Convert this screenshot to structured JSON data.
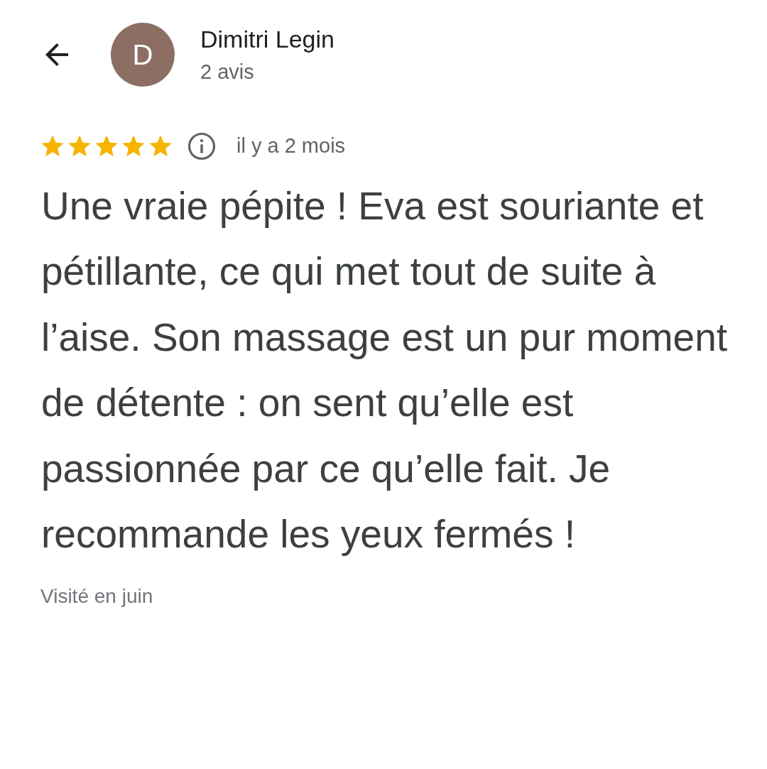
{
  "reviewer": {
    "initial": "D",
    "name": "Dimitri Legin",
    "review_count": "2 avis"
  },
  "review": {
    "stars": 5,
    "time": "il y a 2 mois",
    "text": "Une vraie pépite ! Eva est souriante et pétillante, ce qui met tout de suite à l’aise. Son massage est un pur moment de détente : on sent qu’elle est passionnée par ce qu’elle fait. Je recommande les yeux fermés !",
    "visited": "Visité en juin"
  }
}
